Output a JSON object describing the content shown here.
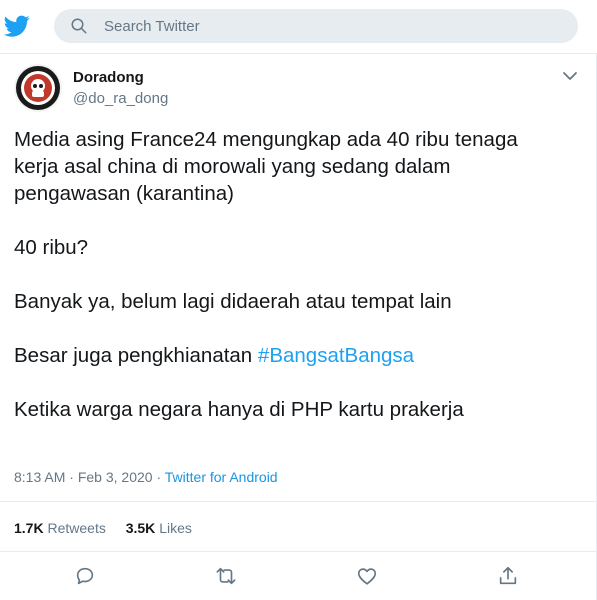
{
  "header": {
    "search_placeholder": "Search Twitter",
    "colors": {
      "brand": "#1da1f2",
      "search_bg": "#e6ecf0"
    }
  },
  "tweet": {
    "author": {
      "name": "Doradong",
      "handle": "@do_ra_dong",
      "avatar_icon": "avatar-badge-icon"
    },
    "body": {
      "line1": "Media asing France24 mengungkap ada 40 ribu tenaga",
      "line2": "kerja asal china di morowali yang sedang dalam",
      "line3": "pengawasan (karantina)",
      "line4": "40 ribu?",
      "line5": "Banyak ya, belum lagi didaerah atau tempat lain",
      "line6_prefix": "Besar juga pengkhianatan ",
      "hashtag": "#BangsatBangsa",
      "line7": "Ketika warga negara hanya di PHP kartu prakerja"
    },
    "time": "8:13 AM",
    "separator": "·",
    "date": "Feb 3, 2020",
    "separator2": "·",
    "source": "Twitter for Android",
    "stats": {
      "retweets_count": "1.7K",
      "retweets_label": "Retweets",
      "likes_count": "3.5K",
      "likes_label": "Likes"
    },
    "actions": [
      "reply-icon",
      "retweet-icon",
      "like-icon",
      "share-icon"
    ]
  }
}
